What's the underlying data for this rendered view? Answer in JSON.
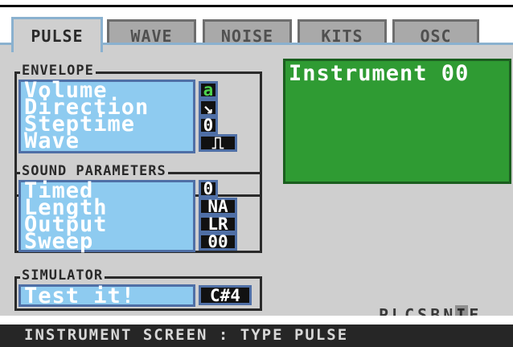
{
  "tabs": [
    {
      "label": "PULSE",
      "active": true
    },
    {
      "label": "WAVE",
      "active": false
    },
    {
      "label": "NOISE",
      "active": false
    },
    {
      "label": "KITS",
      "active": false
    },
    {
      "label": "OSC",
      "active": false
    }
  ],
  "envelope": {
    "title": "ENVELOPE",
    "volume_label": "Volume",
    "volume_value": "a",
    "direction_label": "Direction",
    "direction_value": "↘",
    "steptime_label": "Steptime",
    "steptime_value": "0",
    "wave_label": "Wave",
    "wave_value": "⎍"
  },
  "sound_parameters": {
    "title": "SOUND PARAMETERS",
    "timed_label": "Timed",
    "timed_value": "0",
    "length_label": "Length",
    "length_value": "NA",
    "output_label": "Output",
    "output_value": "LR",
    "sweep_label": "Sweep",
    "sweep_value": "00"
  },
  "simulator": {
    "title": "SIMULATOR",
    "test_label": "Test it!",
    "note_value": "C#4"
  },
  "instrument": {
    "title": "Instrument 00"
  },
  "nav_letters": [
    "P",
    "L",
    "C",
    "S",
    "B",
    "N",
    "I",
    "E"
  ],
  "nav_selected_index": 6,
  "status": "INSTRUMENT SCREEN : TYPE PULSE",
  "colors": {
    "panel_bg": "#cfcfcf",
    "label_bg": "#8ecbf0",
    "instrument_bg": "#2f9b33",
    "value_bg": "#111111",
    "highlight_value": "#4dd14d"
  }
}
